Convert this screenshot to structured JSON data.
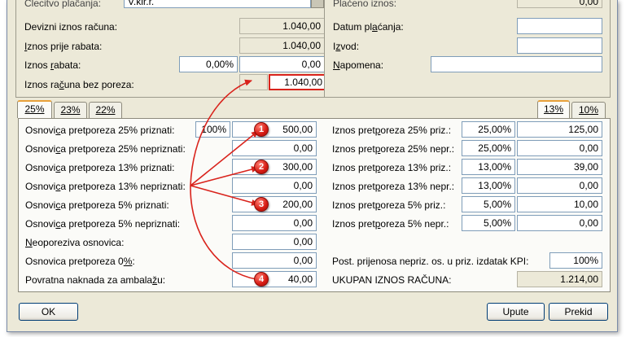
{
  "header": {
    "top_left_label": "Ĉlecitvo plaĉanja:",
    "top_left_value": "V.kir.r.",
    "top_right_label": "Plaćeno iznos:",
    "top_right_value": "0,00",
    "rows_left": [
      {
        "label_pre": "Devizni iznos računa:",
        "u": "",
        "label_post": "",
        "value": "1.040,00"
      },
      {
        "label_pre": "",
        "u": "I",
        "label_post": "znos prije rabata:",
        "value": "1.040,00"
      },
      {
        "label_pre": "Iznos ",
        "u": "r",
        "label_post": "abata:",
        "pct": "0,00%",
        "value": "0,00"
      },
      {
        "label_pre": "Iznos ra",
        "u": "č",
        "label_post": "una bez poreza:",
        "value": "1.040,00"
      }
    ],
    "rows_right": [
      {
        "label_pre": "Datum pl",
        "u": "a",
        "label_post": "ćanja:",
        "value": ""
      },
      {
        "label_pre": "I",
        "u": "z",
        "label_post": "vod:",
        "value": ""
      },
      {
        "label_pre": "",
        "u": "N",
        "label_post": "apomena:",
        "value": ""
      }
    ]
  },
  "tabs_left": [
    "25%",
    "23%",
    "22%"
  ],
  "tabs_right": [
    "13%",
    "10%"
  ],
  "left_rows": [
    {
      "label_pre": "Osnovi",
      "u": "c",
      "label_post": "a pretporeza 25% priznati:",
      "pct": "100%",
      "value": "500,00"
    },
    {
      "label_pre": "Osnovi",
      "u": "c",
      "label_post": "a pretporeza 25% nepriznati:",
      "value": "0,00"
    },
    {
      "label_pre": "Osnovi",
      "u": "c",
      "label_post": "a pretporeza 13% priznati:",
      "value": "300,00"
    },
    {
      "label_pre": "Osnovi",
      "u": "c",
      "label_post": "a pretporeza 13% nepriznati:",
      "value": "0,00"
    },
    {
      "label_pre": "Osnovi",
      "u": "c",
      "label_post": "a pretporeza 5% priznati:",
      "value": "200,00"
    },
    {
      "label_pre": "Osnovi",
      "u": "c",
      "label_post": "a pretporeza 5% nepriznati:",
      "value": "0,00"
    },
    {
      "label_pre": "",
      "u": "N",
      "label_post": "eoporeziva osnovica:",
      "value": "0,00"
    },
    {
      "label_pre": "Osnovica pretporeza 0",
      "u": "%",
      "label_post": ":",
      "value": "0,00"
    },
    {
      "label_pre": "Povratna naknada za ambala",
      "u": "ž",
      "label_post": "u:",
      "value": "40,00"
    }
  ],
  "right_rows": [
    {
      "label_pre": "Iznos pret",
      "u": "p",
      "label_post": "oreza 25% priz.:",
      "pct": "25,00%",
      "value": "125,00"
    },
    {
      "label_pre": "Iznos pret",
      "u": "p",
      "label_post": "oreza 25% nepr.:",
      "pct": "25,00%",
      "value": "0,00"
    },
    {
      "label_pre": "Iznos pret",
      "u": "p",
      "label_post": "oreza 13% priz.:",
      "pct": "13,00%",
      "value": "39,00"
    },
    {
      "label_pre": "Iznos pret",
      "u": "p",
      "label_post": "oreza 13% nepr.:",
      "pct": "13,00%",
      "value": "0,00"
    },
    {
      "label_pre": "Iznos pret",
      "u": "p",
      "label_post": "oreza 5% priz.:",
      "pct": "5,00%",
      "value": "10,00"
    },
    {
      "label_pre": "Iznos pret",
      "u": "p",
      "label_post": "oreza 5% nepr.:",
      "pct": "5,00%",
      "value": "0,00"
    }
  ],
  "kpi": {
    "label": "Post. prijenosa nepriz. os. u priz. izdatak KPI:",
    "value": "100%"
  },
  "total": {
    "label": "UKUPAN IZNOS RAČUNA:",
    "value": "1.214,00"
  },
  "badges": [
    "1",
    "2",
    "3",
    "4"
  ],
  "buttons": {
    "ok": "OK",
    "upute": "Upute",
    "prekid": "Prekid"
  },
  "colors": {
    "annotation": "#d9231c",
    "window_bg": "#ece9d8"
  }
}
